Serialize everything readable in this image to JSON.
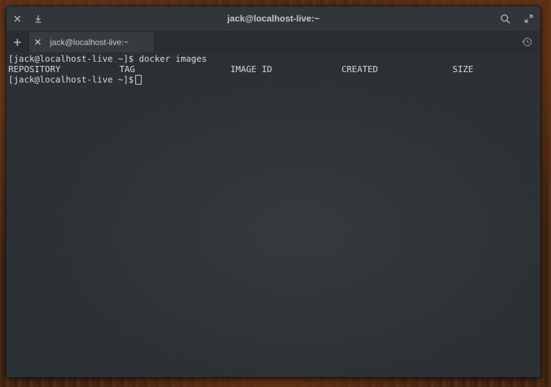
{
  "window": {
    "title": "jack@localhost-live:~"
  },
  "titlebar": {
    "close_icon": "close-icon",
    "download_icon": "download-icon",
    "search_icon": "search-icon",
    "maximize_icon": "maximize-icon"
  },
  "tabs": [
    {
      "label": "jack@localhost-live:~",
      "active": true
    }
  ],
  "terminal": {
    "lines": [
      {
        "prompt": "[jack@localhost-live ~]$",
        "command": "docker images"
      }
    ],
    "header": {
      "repository": "REPOSITORY",
      "tag": "TAG",
      "image_id": "IMAGE ID",
      "created": "CREATED",
      "size": "SIZE"
    },
    "current_prompt": "[jack@localhost-live ~]$"
  },
  "colors": {
    "terminal_bg": "#2c3135",
    "titlebar_bg": "#31363b",
    "text": "#d5d9dc"
  }
}
